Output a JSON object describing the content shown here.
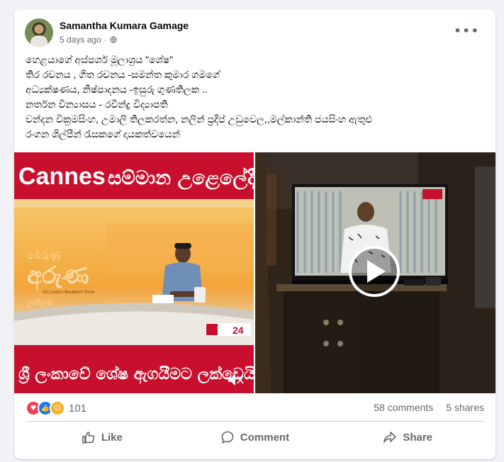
{
  "post": {
    "author": "Samantha Kumara Gamage",
    "time": "5 days ago",
    "dot": "·",
    "more": "•••",
    "caption": [
      "හෙළයාගේ අස්පර්ශ මූලාශ්‍රය \"ශේෂ\"",
      "තිර රචනය , ගීත රචනය -සමන්ත කුමාර ගමගේ",
      "අධ්‍යක්ෂණය, නිෂ්පාදනය -ඉසුරු ගුණතිලක ..",
      "නර්තන වින්‍යාසය - රවීන්ද්‍ර විද්‍යාපති",
      "චන්දන වික්‍රමසිංහ, උමාලි තිලකරත්න, නලින් ප්‍රදීප් උඩුවෙල,,මල්කාන්ති ජයසිංහ ඇතුළු",
      "රංගන ශිල්පීන් රැසකගේ දායකත්වයෙන්"
    ]
  },
  "media": {
    "image1": {
      "headline_en": "Cannes",
      "headline_si": "සම්මාන උළෙලේදී",
      "bottom": "ශ්‍රී ලංකාවේ ශේෂ ඇගයීමට ලක්වෙයි",
      "logo_text": "Sri Lanka's Breakfast Show",
      "channel": "24"
    },
    "image2": {
      "play_label": "Play video"
    }
  },
  "stats": {
    "reaction_count": "101",
    "comments": "58 comments",
    "shares": "5 shares"
  },
  "actions": {
    "like": "Like",
    "comment": "Comment",
    "share": "Share"
  },
  "colors": {
    "brand_red": "#c8102e",
    "facebook_blue": "#1877f2"
  }
}
